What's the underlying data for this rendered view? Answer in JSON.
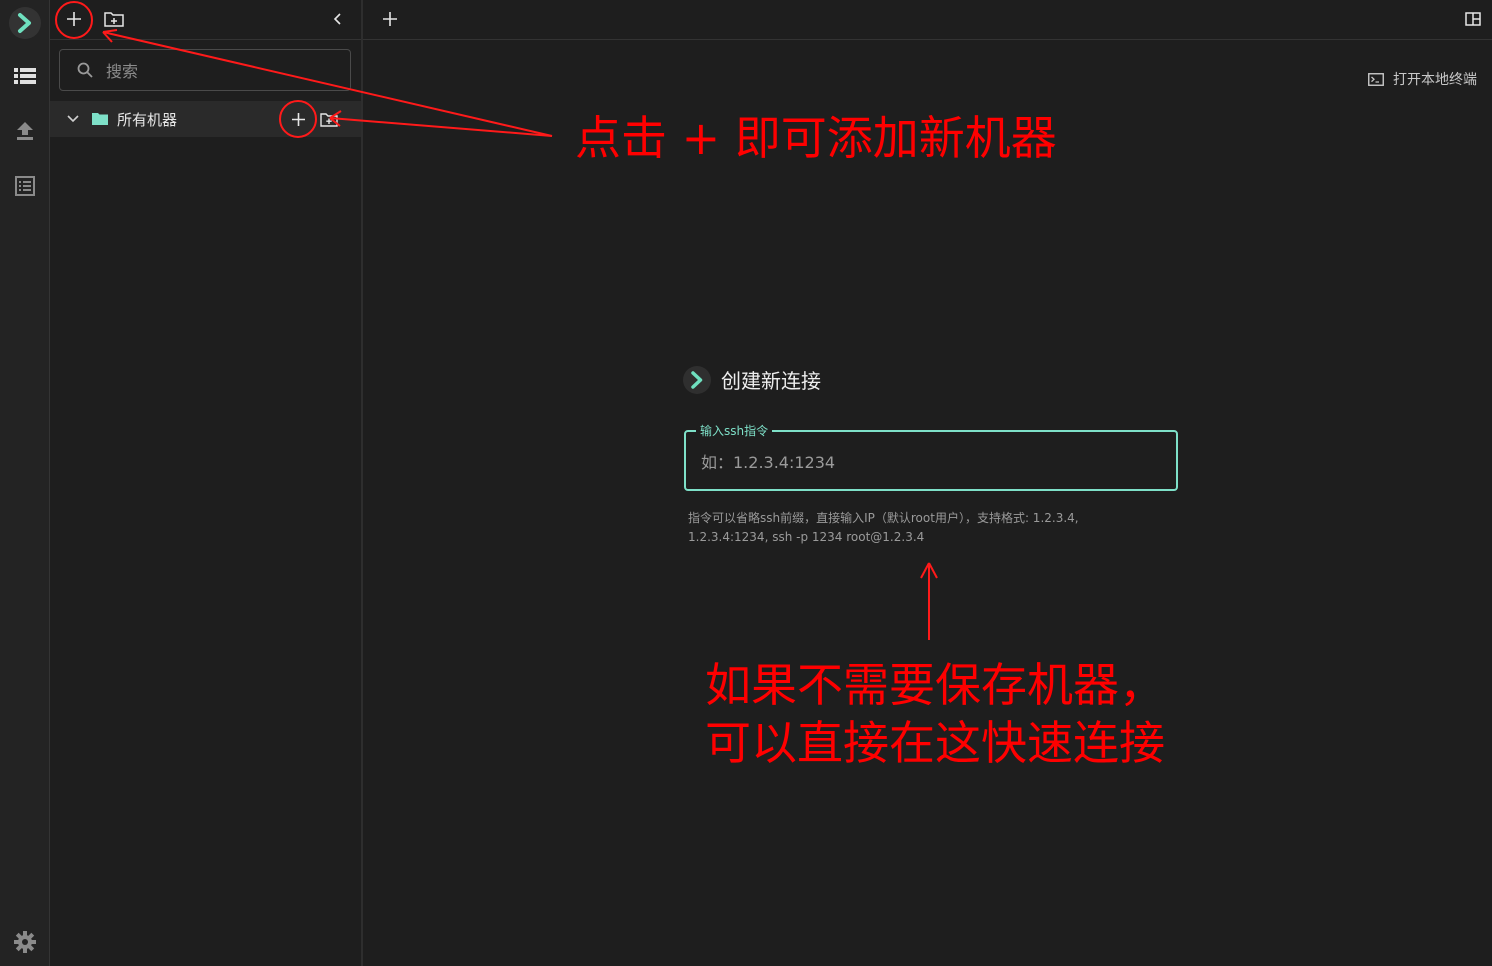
{
  "sidebar": {
    "search_placeholder": "搜索",
    "tree": {
      "all_machines_label": "所有机器"
    }
  },
  "main": {
    "open_local_terminal": "打开本地终端",
    "new_connection": {
      "title": "创建新连接",
      "ssh_field_label": "输入ssh指令",
      "ssh_placeholder": "如：1.2.3.4:1234",
      "hint_line1": "指令可以省略ssh前缀，直接输入IP（默认root用户），支持格式: 1.2.3.4,",
      "hint_line2": "1.2.3.4:1234, ssh -p 1234 root@1.2.3.4"
    }
  },
  "annotations": {
    "add_machine": "点击 + 即可添加新机器",
    "quick_connect_line1": "如果不需要保存机器，",
    "quick_connect_line2": "可以直接在这快速连接"
  },
  "colors": {
    "accent": "#7ee0c8",
    "annotation": "#ff0000"
  },
  "icons": {
    "logo": "chevron-logo-icon",
    "sessions": "list-icon",
    "upload": "upload-icon",
    "logs": "log-list-icon",
    "settings": "gear-icon",
    "new_machine": "plus-icon",
    "new_folder": "folder-plus-icon",
    "collapse": "chevron-left-icon",
    "layout": "split-layout-icon",
    "terminal": "terminal-icon",
    "folder": "folder-icon"
  }
}
